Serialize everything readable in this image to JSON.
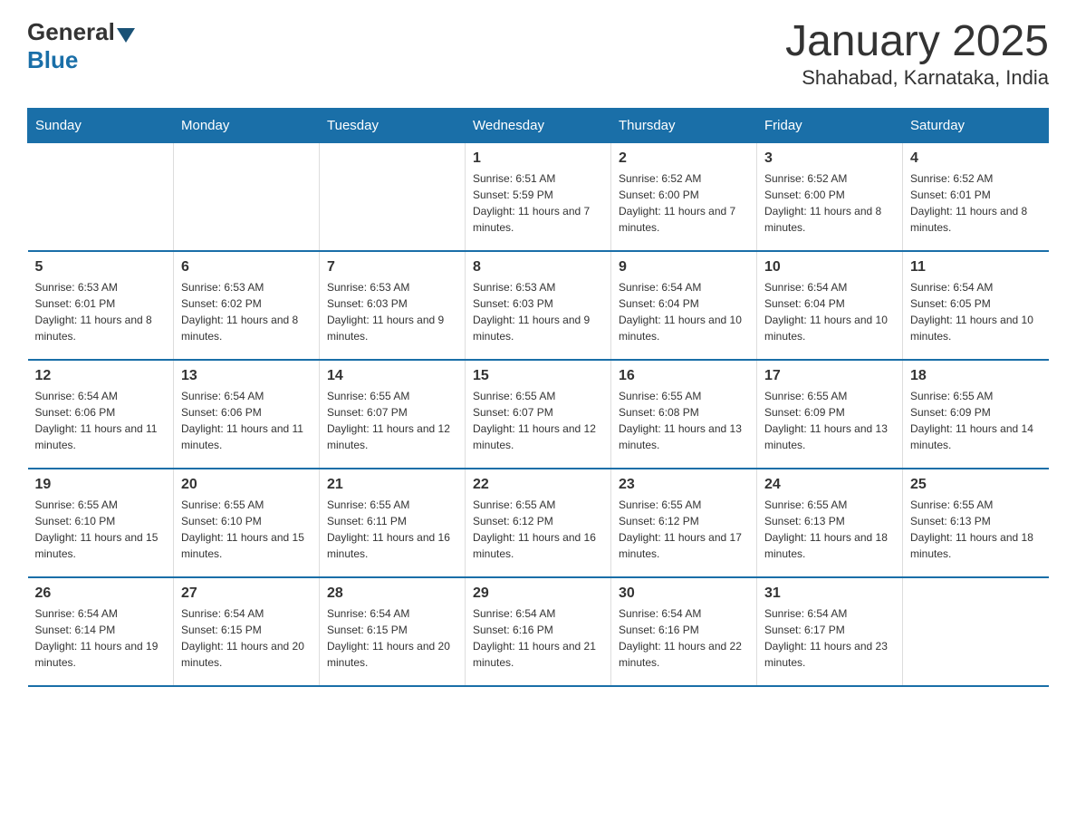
{
  "header": {
    "logo_general": "General",
    "logo_blue": "Blue",
    "month_title": "January 2025",
    "location": "Shahabad, Karnataka, India"
  },
  "days_of_week": [
    "Sunday",
    "Monday",
    "Tuesday",
    "Wednesday",
    "Thursday",
    "Friday",
    "Saturday"
  ],
  "weeks": [
    {
      "days": [
        {
          "number": "",
          "info": ""
        },
        {
          "number": "",
          "info": ""
        },
        {
          "number": "",
          "info": ""
        },
        {
          "number": "1",
          "info": "Sunrise: 6:51 AM\nSunset: 5:59 PM\nDaylight: 11 hours and 7 minutes."
        },
        {
          "number": "2",
          "info": "Sunrise: 6:52 AM\nSunset: 6:00 PM\nDaylight: 11 hours and 7 minutes."
        },
        {
          "number": "3",
          "info": "Sunrise: 6:52 AM\nSunset: 6:00 PM\nDaylight: 11 hours and 8 minutes."
        },
        {
          "number": "4",
          "info": "Sunrise: 6:52 AM\nSunset: 6:01 PM\nDaylight: 11 hours and 8 minutes."
        }
      ]
    },
    {
      "days": [
        {
          "number": "5",
          "info": "Sunrise: 6:53 AM\nSunset: 6:01 PM\nDaylight: 11 hours and 8 minutes."
        },
        {
          "number": "6",
          "info": "Sunrise: 6:53 AM\nSunset: 6:02 PM\nDaylight: 11 hours and 8 minutes."
        },
        {
          "number": "7",
          "info": "Sunrise: 6:53 AM\nSunset: 6:03 PM\nDaylight: 11 hours and 9 minutes."
        },
        {
          "number": "8",
          "info": "Sunrise: 6:53 AM\nSunset: 6:03 PM\nDaylight: 11 hours and 9 minutes."
        },
        {
          "number": "9",
          "info": "Sunrise: 6:54 AM\nSunset: 6:04 PM\nDaylight: 11 hours and 10 minutes."
        },
        {
          "number": "10",
          "info": "Sunrise: 6:54 AM\nSunset: 6:04 PM\nDaylight: 11 hours and 10 minutes."
        },
        {
          "number": "11",
          "info": "Sunrise: 6:54 AM\nSunset: 6:05 PM\nDaylight: 11 hours and 10 minutes."
        }
      ]
    },
    {
      "days": [
        {
          "number": "12",
          "info": "Sunrise: 6:54 AM\nSunset: 6:06 PM\nDaylight: 11 hours and 11 minutes."
        },
        {
          "number": "13",
          "info": "Sunrise: 6:54 AM\nSunset: 6:06 PM\nDaylight: 11 hours and 11 minutes."
        },
        {
          "number": "14",
          "info": "Sunrise: 6:55 AM\nSunset: 6:07 PM\nDaylight: 11 hours and 12 minutes."
        },
        {
          "number": "15",
          "info": "Sunrise: 6:55 AM\nSunset: 6:07 PM\nDaylight: 11 hours and 12 minutes."
        },
        {
          "number": "16",
          "info": "Sunrise: 6:55 AM\nSunset: 6:08 PM\nDaylight: 11 hours and 13 minutes."
        },
        {
          "number": "17",
          "info": "Sunrise: 6:55 AM\nSunset: 6:09 PM\nDaylight: 11 hours and 13 minutes."
        },
        {
          "number": "18",
          "info": "Sunrise: 6:55 AM\nSunset: 6:09 PM\nDaylight: 11 hours and 14 minutes."
        }
      ]
    },
    {
      "days": [
        {
          "number": "19",
          "info": "Sunrise: 6:55 AM\nSunset: 6:10 PM\nDaylight: 11 hours and 15 minutes."
        },
        {
          "number": "20",
          "info": "Sunrise: 6:55 AM\nSunset: 6:10 PM\nDaylight: 11 hours and 15 minutes."
        },
        {
          "number": "21",
          "info": "Sunrise: 6:55 AM\nSunset: 6:11 PM\nDaylight: 11 hours and 16 minutes."
        },
        {
          "number": "22",
          "info": "Sunrise: 6:55 AM\nSunset: 6:12 PM\nDaylight: 11 hours and 16 minutes."
        },
        {
          "number": "23",
          "info": "Sunrise: 6:55 AM\nSunset: 6:12 PM\nDaylight: 11 hours and 17 minutes."
        },
        {
          "number": "24",
          "info": "Sunrise: 6:55 AM\nSunset: 6:13 PM\nDaylight: 11 hours and 18 minutes."
        },
        {
          "number": "25",
          "info": "Sunrise: 6:55 AM\nSunset: 6:13 PM\nDaylight: 11 hours and 18 minutes."
        }
      ]
    },
    {
      "days": [
        {
          "number": "26",
          "info": "Sunrise: 6:54 AM\nSunset: 6:14 PM\nDaylight: 11 hours and 19 minutes."
        },
        {
          "number": "27",
          "info": "Sunrise: 6:54 AM\nSunset: 6:15 PM\nDaylight: 11 hours and 20 minutes."
        },
        {
          "number": "28",
          "info": "Sunrise: 6:54 AM\nSunset: 6:15 PM\nDaylight: 11 hours and 20 minutes."
        },
        {
          "number": "29",
          "info": "Sunrise: 6:54 AM\nSunset: 6:16 PM\nDaylight: 11 hours and 21 minutes."
        },
        {
          "number": "30",
          "info": "Sunrise: 6:54 AM\nSunset: 6:16 PM\nDaylight: 11 hours and 22 minutes."
        },
        {
          "number": "31",
          "info": "Sunrise: 6:54 AM\nSunset: 6:17 PM\nDaylight: 11 hours and 23 minutes."
        },
        {
          "number": "",
          "info": ""
        }
      ]
    }
  ]
}
